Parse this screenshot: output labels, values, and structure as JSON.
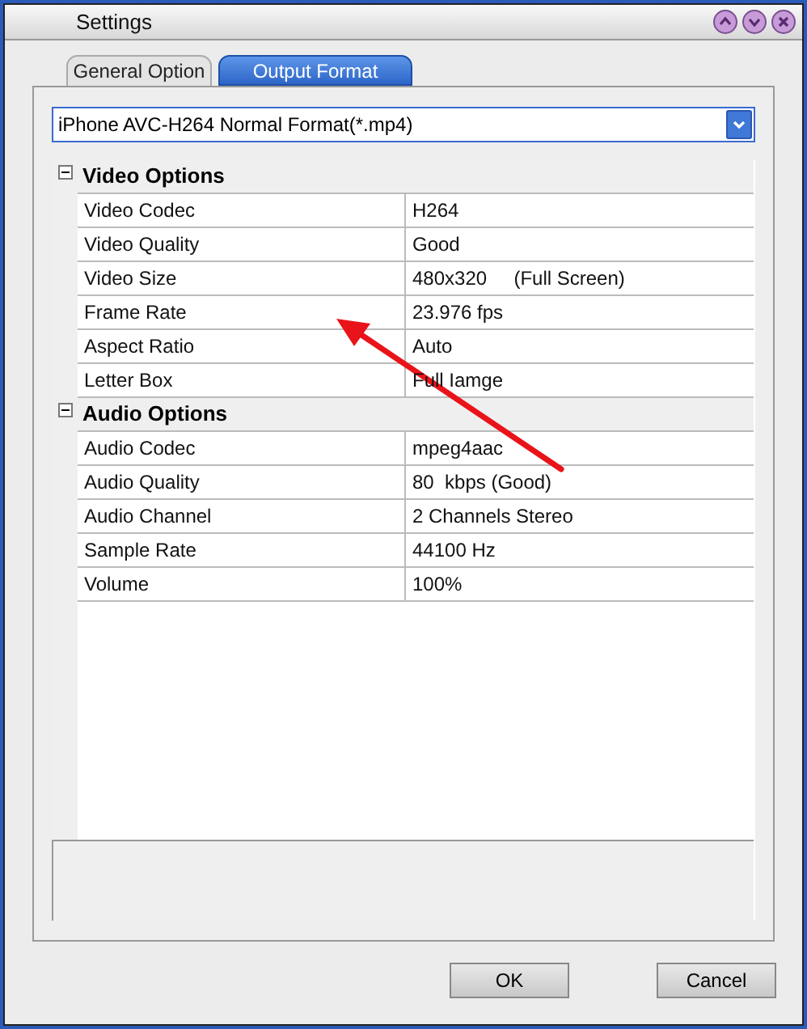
{
  "window": {
    "title": "Settings"
  },
  "tabs": [
    {
      "label": "General Option",
      "selected": false
    },
    {
      "label": "Output Format",
      "selected": true
    }
  ],
  "format_dropdown": {
    "value": "iPhone AVC-H264 Normal Format(*.mp4)"
  },
  "sections": [
    {
      "title": "Video Options",
      "expanded": true,
      "rows": [
        {
          "name": "Video Codec",
          "value": "H264"
        },
        {
          "name": "Video Quality",
          "value": "Good"
        },
        {
          "name": "Video Size",
          "value": "480x320     (Full Screen)"
        },
        {
          "name": "Frame Rate",
          "value": "23.976 fps"
        },
        {
          "name": "Aspect Ratio",
          "value": "Auto"
        },
        {
          "name": "Letter Box",
          "value": "Full Iamge"
        }
      ]
    },
    {
      "title": "Audio Options",
      "expanded": true,
      "rows": [
        {
          "name": "Audio Codec",
          "value": "mpeg4aac"
        },
        {
          "name": "Audio Quality",
          "value": "80  kbps (Good)"
        },
        {
          "name": "Audio Channel",
          "value": "2 Channels Stereo"
        },
        {
          "name": "Sample Rate",
          "value": "44100 Hz"
        },
        {
          "name": "Volume",
          "value": "100%"
        }
      ]
    }
  ],
  "annotation": {
    "kind": "arrow"
  },
  "buttons": [
    "OK",
    "Cancel"
  ]
}
